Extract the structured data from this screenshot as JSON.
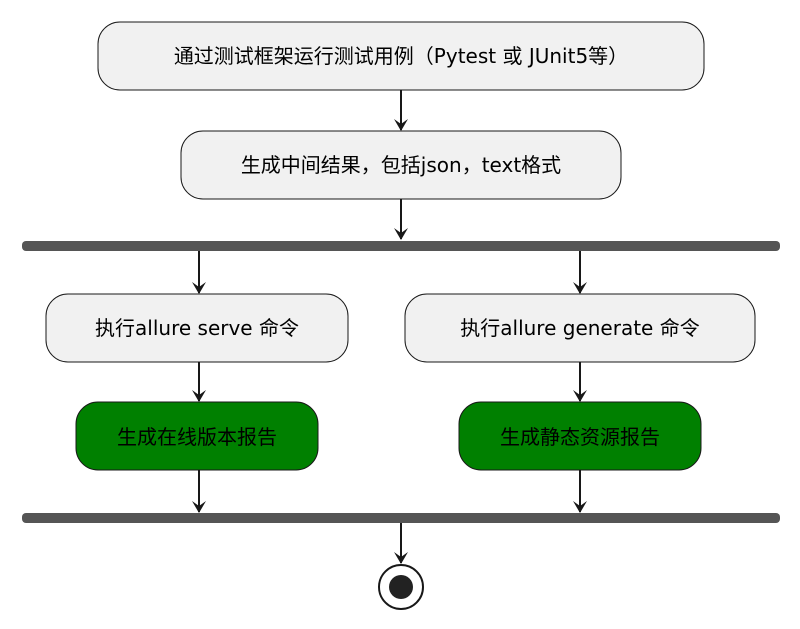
{
  "nodes": {
    "run_tests": "通过测试框架运行测试用例（Pytest 或 JUnit5等）",
    "intermediate": "生成中间结果，包括json，text格式",
    "serve_cmd": "执行allure serve 命令",
    "generate_cmd": "执行allure generate 命令",
    "online_report": "生成在线版本报告",
    "static_report": "生成静态资源报告"
  },
  "colors": {
    "action_fill": "#F1F1F1",
    "result_fill": "#008000",
    "border": "#181818",
    "bar": "#555555",
    "arrow": "#181818",
    "end_fill": "#222222"
  }
}
